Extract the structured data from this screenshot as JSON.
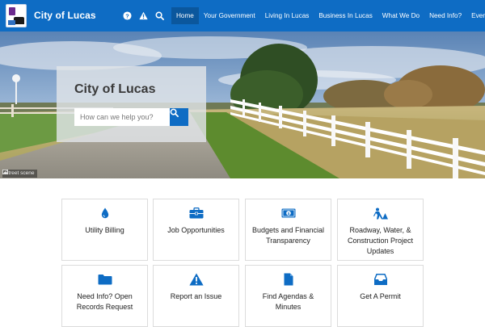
{
  "header": {
    "title": "City of Lucas",
    "icons": [
      "help-icon",
      "alert-icon",
      "search-icon"
    ],
    "nav": [
      {
        "label": "Home",
        "active": true
      },
      {
        "label": "Your Government",
        "active": false
      },
      {
        "label": "Living In Lucas",
        "active": false
      },
      {
        "label": "Business In Lucas",
        "active": false
      },
      {
        "label": "What We Do",
        "active": false
      },
      {
        "label": "Need Info?",
        "active": false
      },
      {
        "label": "Events",
        "active": false
      }
    ]
  },
  "hero": {
    "title": "City of Lucas",
    "search_placeholder": "How can we help you?",
    "caption": "Street scene"
  },
  "tiles": [
    {
      "label": "Utility Billing",
      "icon": "water-drop-icon"
    },
    {
      "label": "Job Opportunities",
      "icon": "briefcase-icon"
    },
    {
      "label": "Budgets and Financial Transparency",
      "icon": "money-icon"
    },
    {
      "label": "Roadway, Water, & Construction Project Updates",
      "icon": "road-worker-icon"
    },
    {
      "label": "Need Info? Open Records Request",
      "icon": "folder-icon"
    },
    {
      "label": "Report an Issue",
      "icon": "warning-icon"
    },
    {
      "label": "Find Agendas & Minutes",
      "icon": "document-icon"
    },
    {
      "label": "Get A Permit",
      "icon": "inbox-icon"
    }
  ],
  "colors": {
    "brand": "#0e6cc4",
    "nav_active": "#0b579d",
    "icon": "#0e6cc4"
  }
}
